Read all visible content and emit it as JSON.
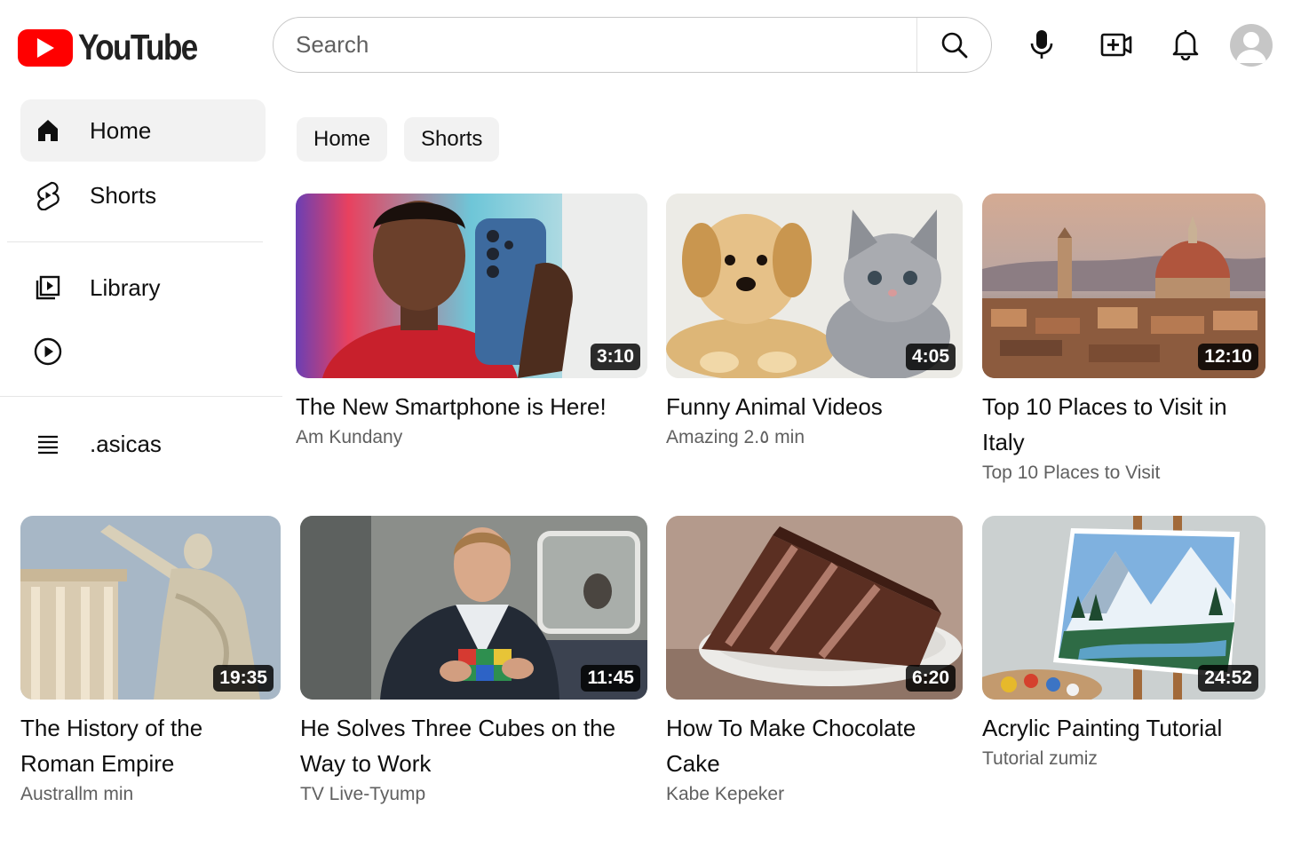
{
  "header": {
    "logo_text": "YouTube",
    "search_placeholder": "Search",
    "icons": [
      "youtube-logo-icon",
      "search-icon",
      "microphone-icon",
      "create-video-icon",
      "notifications-bell-icon",
      "account-avatar-icon"
    ]
  },
  "sidebar": {
    "items": [
      {
        "label": "Home",
        "icon": "home-icon",
        "active": true
      },
      {
        "label": "Shorts",
        "icon": "shorts-icon"
      },
      {
        "label": "Library",
        "icon": "library-icon"
      },
      {
        "label": "",
        "icon": "play-circle-icon"
      },
      {
        "label": ".asicas",
        "icon": "list-icon"
      }
    ]
  },
  "chips": [
    "Home",
    "Shorts"
  ],
  "videos": [
    {
      "title": "The New Smartphone is Here!",
      "channel": "Am Kundany",
      "duration": "3:10"
    },
    {
      "title": "Funny Animal Videos",
      "channel": "Amazing 2.٥ min",
      "duration": "4:05"
    },
    {
      "title": "Top 10 Places to Visit in Italy",
      "channel": "Top 10 Places to Visit",
      "duration": "12:10"
    },
    {
      "title": "The History of the Roman Empire",
      "channel": "Australlm min",
      "duration": "19:35"
    },
    {
      "title": "He Solves Three Cubes on the Way to Work",
      "channel": "TV Live-Tyump",
      "duration": "11:45"
    },
    {
      "title": "How To Make Chocolate Cake",
      "channel": "Kabe Kepeker",
      "duration": "6:20"
    },
    {
      "title": "Acrylic Painting Tutorial",
      "channel": "Tutorial zumiz",
      "duration": "24:52"
    }
  ],
  "colors": {
    "brand_red": "#ff0000",
    "text_primary": "#0f0f0f",
    "text_secondary": "#606060",
    "chip_bg": "#f2f2f2"
  }
}
